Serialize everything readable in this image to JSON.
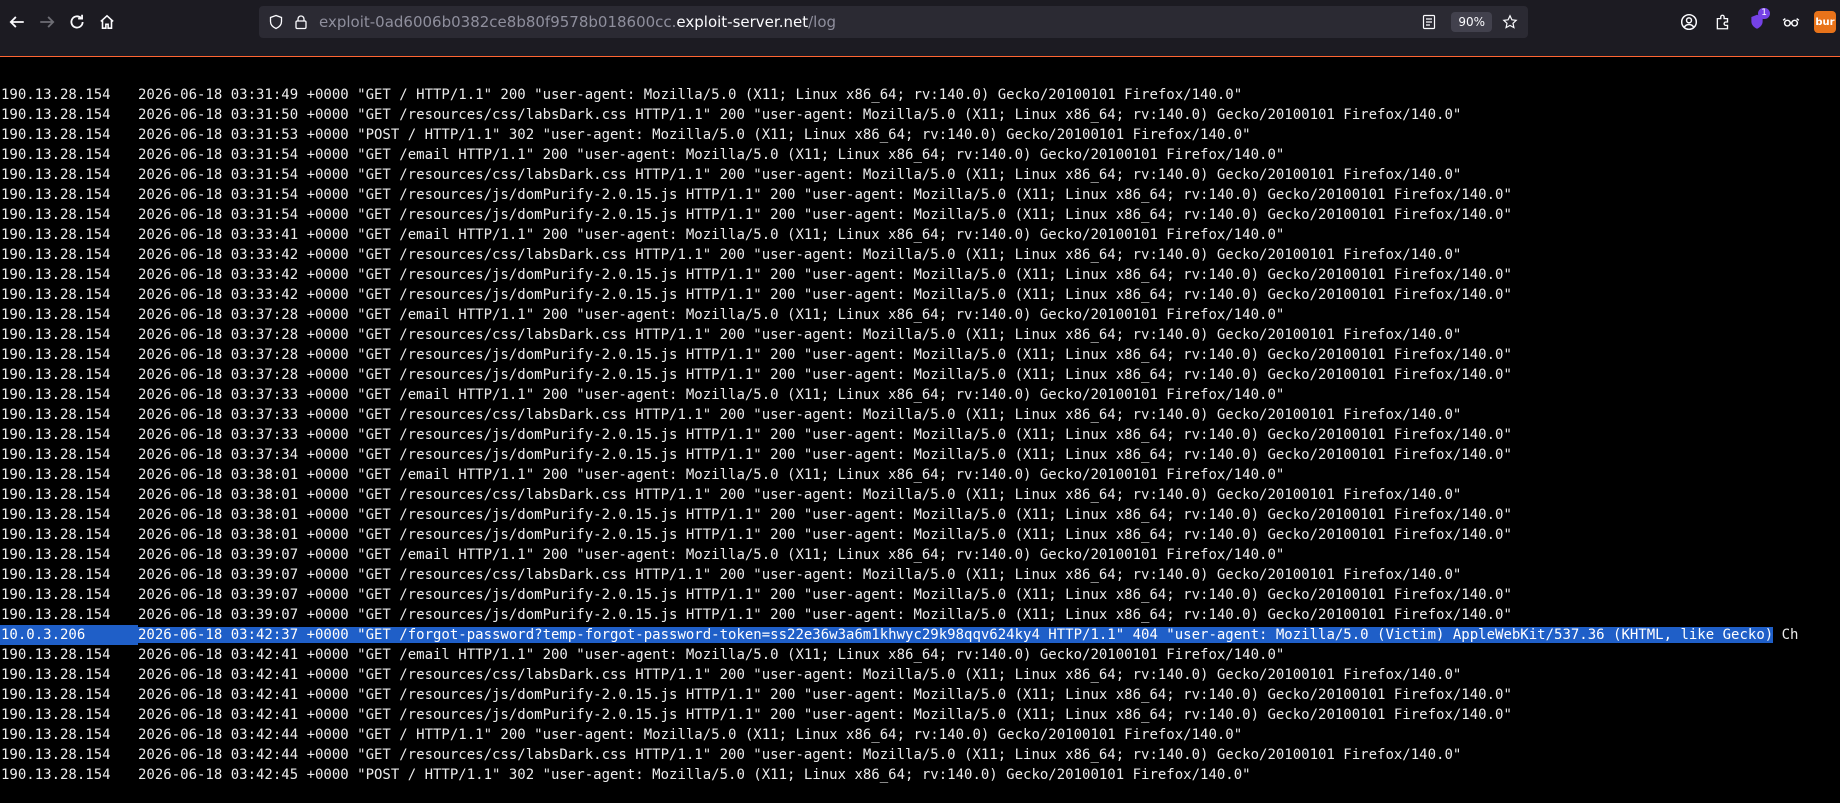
{
  "browser": {
    "url_prefix": "exploit-0ad6006b0382ce8b80f9578b018600cc.",
    "url_host": "exploit-server.net",
    "url_path": "/log",
    "zoom": "90%",
    "extension_badge": "1",
    "burp_label": "bur"
  },
  "log": {
    "selected_row_index": 27,
    "rows": [
      {
        "ip": "190.13.28.154",
        "rest": "2026-06-18 03:31:49 +0000 \"GET / HTTP/1.1\" 200 \"user-agent: Mozilla/5.0 (X11; Linux x86_64; rv:140.0) Gecko/20100101 Firefox/140.0\""
      },
      {
        "ip": "190.13.28.154",
        "rest": "2026-06-18 03:31:50 +0000 \"GET /resources/css/labsDark.css HTTP/1.1\" 200 \"user-agent: Mozilla/5.0 (X11; Linux x86_64; rv:140.0) Gecko/20100101 Firefox/140.0\""
      },
      {
        "ip": "190.13.28.154",
        "rest": "2026-06-18 03:31:53 +0000 \"POST / HTTP/1.1\" 302 \"user-agent: Mozilla/5.0 (X11; Linux x86_64; rv:140.0) Gecko/20100101 Firefox/140.0\""
      },
      {
        "ip": "190.13.28.154",
        "rest": "2026-06-18 03:31:54 +0000 \"GET /email HTTP/1.1\" 200 \"user-agent: Mozilla/5.0 (X11; Linux x86_64; rv:140.0) Gecko/20100101 Firefox/140.0\""
      },
      {
        "ip": "190.13.28.154",
        "rest": "2026-06-18 03:31:54 +0000 \"GET /resources/css/labsDark.css HTTP/1.1\" 200 \"user-agent: Mozilla/5.0 (X11; Linux x86_64; rv:140.0) Gecko/20100101 Firefox/140.0\""
      },
      {
        "ip": "190.13.28.154",
        "rest": "2026-06-18 03:31:54 +0000 \"GET /resources/js/domPurify-2.0.15.js HTTP/1.1\" 200 \"user-agent: Mozilla/5.0 (X11; Linux x86_64; rv:140.0) Gecko/20100101 Firefox/140.0\""
      },
      {
        "ip": "190.13.28.154",
        "rest": "2026-06-18 03:31:54 +0000 \"GET /resources/js/domPurify-2.0.15.js HTTP/1.1\" 200 \"user-agent: Mozilla/5.0 (X11; Linux x86_64; rv:140.0) Gecko/20100101 Firefox/140.0\""
      },
      {
        "ip": "190.13.28.154",
        "rest": "2026-06-18 03:33:41 +0000 \"GET /email HTTP/1.1\" 200 \"user-agent: Mozilla/5.0 (X11; Linux x86_64; rv:140.0) Gecko/20100101 Firefox/140.0\""
      },
      {
        "ip": "190.13.28.154",
        "rest": "2026-06-18 03:33:42 +0000 \"GET /resources/css/labsDark.css HTTP/1.1\" 200 \"user-agent: Mozilla/5.0 (X11; Linux x86_64; rv:140.0) Gecko/20100101 Firefox/140.0\""
      },
      {
        "ip": "190.13.28.154",
        "rest": "2026-06-18 03:33:42 +0000 \"GET /resources/js/domPurify-2.0.15.js HTTP/1.1\" 200 \"user-agent: Mozilla/5.0 (X11; Linux x86_64; rv:140.0) Gecko/20100101 Firefox/140.0\""
      },
      {
        "ip": "190.13.28.154",
        "rest": "2026-06-18 03:33:42 +0000 \"GET /resources/js/domPurify-2.0.15.js HTTP/1.1\" 200 \"user-agent: Mozilla/5.0 (X11; Linux x86_64; rv:140.0) Gecko/20100101 Firefox/140.0\""
      },
      {
        "ip": "190.13.28.154",
        "rest": "2026-06-18 03:37:28 +0000 \"GET /email HTTP/1.1\" 200 \"user-agent: Mozilla/5.0 (X11; Linux x86_64; rv:140.0) Gecko/20100101 Firefox/140.0\""
      },
      {
        "ip": "190.13.28.154",
        "rest": "2026-06-18 03:37:28 +0000 \"GET /resources/css/labsDark.css HTTP/1.1\" 200 \"user-agent: Mozilla/5.0 (X11; Linux x86_64; rv:140.0) Gecko/20100101 Firefox/140.0\""
      },
      {
        "ip": "190.13.28.154",
        "rest": "2026-06-18 03:37:28 +0000 \"GET /resources/js/domPurify-2.0.15.js HTTP/1.1\" 200 \"user-agent: Mozilla/5.0 (X11; Linux x86_64; rv:140.0) Gecko/20100101 Firefox/140.0\""
      },
      {
        "ip": "190.13.28.154",
        "rest": "2026-06-18 03:37:28 +0000 \"GET /resources/js/domPurify-2.0.15.js HTTP/1.1\" 200 \"user-agent: Mozilla/5.0 (X11; Linux x86_64; rv:140.0) Gecko/20100101 Firefox/140.0\""
      },
      {
        "ip": "190.13.28.154",
        "rest": "2026-06-18 03:37:33 +0000 \"GET /email HTTP/1.1\" 200 \"user-agent: Mozilla/5.0 (X11; Linux x86_64; rv:140.0) Gecko/20100101 Firefox/140.0\""
      },
      {
        "ip": "190.13.28.154",
        "rest": "2026-06-18 03:37:33 +0000 \"GET /resources/css/labsDark.css HTTP/1.1\" 200 \"user-agent: Mozilla/5.0 (X11; Linux x86_64; rv:140.0) Gecko/20100101 Firefox/140.0\""
      },
      {
        "ip": "190.13.28.154",
        "rest": "2026-06-18 03:37:33 +0000 \"GET /resources/js/domPurify-2.0.15.js HTTP/1.1\" 200 \"user-agent: Mozilla/5.0 (X11; Linux x86_64; rv:140.0) Gecko/20100101 Firefox/140.0\""
      },
      {
        "ip": "190.13.28.154",
        "rest": "2026-06-18 03:37:34 +0000 \"GET /resources/js/domPurify-2.0.15.js HTTP/1.1\" 200 \"user-agent: Mozilla/5.0 (X11; Linux x86_64; rv:140.0) Gecko/20100101 Firefox/140.0\""
      },
      {
        "ip": "190.13.28.154",
        "rest": "2026-06-18 03:38:01 +0000 \"GET /email HTTP/1.1\" 200 \"user-agent: Mozilla/5.0 (X11; Linux x86_64; rv:140.0) Gecko/20100101 Firefox/140.0\""
      },
      {
        "ip": "190.13.28.154",
        "rest": "2026-06-18 03:38:01 +0000 \"GET /resources/css/labsDark.css HTTP/1.1\" 200 \"user-agent: Mozilla/5.0 (X11; Linux x86_64; rv:140.0) Gecko/20100101 Firefox/140.0\""
      },
      {
        "ip": "190.13.28.154",
        "rest": "2026-06-18 03:38:01 +0000 \"GET /resources/js/domPurify-2.0.15.js HTTP/1.1\" 200 \"user-agent: Mozilla/5.0 (X11; Linux x86_64; rv:140.0) Gecko/20100101 Firefox/140.0\""
      },
      {
        "ip": "190.13.28.154",
        "rest": "2026-06-18 03:38:01 +0000 \"GET /resources/js/domPurify-2.0.15.js HTTP/1.1\" 200 \"user-agent: Mozilla/5.0 (X11; Linux x86_64; rv:140.0) Gecko/20100101 Firefox/140.0\""
      },
      {
        "ip": "190.13.28.154",
        "rest": "2026-06-18 03:39:07 +0000 \"GET /email HTTP/1.1\" 200 \"user-agent: Mozilla/5.0 (X11; Linux x86_64; rv:140.0) Gecko/20100101 Firefox/140.0\""
      },
      {
        "ip": "190.13.28.154",
        "rest": "2026-06-18 03:39:07 +0000 \"GET /resources/css/labsDark.css HTTP/1.1\" 200 \"user-agent: Mozilla/5.0 (X11; Linux x86_64; rv:140.0) Gecko/20100101 Firefox/140.0\""
      },
      {
        "ip": "190.13.28.154",
        "rest": "2026-06-18 03:39:07 +0000 \"GET /resources/js/domPurify-2.0.15.js HTTP/1.1\" 200 \"user-agent: Mozilla/5.0 (X11; Linux x86_64; rv:140.0) Gecko/20100101 Firefox/140.0\""
      },
      {
        "ip": "190.13.28.154",
        "rest": "2026-06-18 03:39:07 +0000 \"GET /resources/js/domPurify-2.0.15.js HTTP/1.1\" 200 \"user-agent: Mozilla/5.0 (X11; Linux x86_64; rv:140.0) Gecko/20100101 Firefox/140.0\""
      },
      {
        "ip": "10.0.3.206",
        "rest": "2026-06-18 03:42:37 +0000 \"GET /forgot-password?temp-forgot-password-token=ss22e36w3a6m1khwyc29k98qqv624ky4 HTTP/1.1\" 404 \"user-agent: Mozilla/5.0 (Victim) AppleWebKit/537.36 (KHTML, like Gecko)",
        "tail": " Ch"
      },
      {
        "ip": "190.13.28.154",
        "rest": "2026-06-18 03:42:41 +0000 \"GET /email HTTP/1.1\" 200 \"user-agent: Mozilla/5.0 (X11; Linux x86_64; rv:140.0) Gecko/20100101 Firefox/140.0\""
      },
      {
        "ip": "190.13.28.154",
        "rest": "2026-06-18 03:42:41 +0000 \"GET /resources/css/labsDark.css HTTP/1.1\" 200 \"user-agent: Mozilla/5.0 (X11; Linux x86_64; rv:140.0) Gecko/20100101 Firefox/140.0\""
      },
      {
        "ip": "190.13.28.154",
        "rest": "2026-06-18 03:42:41 +0000 \"GET /resources/js/domPurify-2.0.15.js HTTP/1.1\" 200 \"user-agent: Mozilla/5.0 (X11; Linux x86_64; rv:140.0) Gecko/20100101 Firefox/140.0\""
      },
      {
        "ip": "190.13.28.154",
        "rest": "2026-06-18 03:42:41 +0000 \"GET /resources/js/domPurify-2.0.15.js HTTP/1.1\" 200 \"user-agent: Mozilla/5.0 (X11; Linux x86_64; rv:140.0) Gecko/20100101 Firefox/140.0\""
      },
      {
        "ip": "190.13.28.154",
        "rest": "2026-06-18 03:42:44 +0000 \"GET / HTTP/1.1\" 200 \"user-agent: Mozilla/5.0 (X11; Linux x86_64; rv:140.0) Gecko/20100101 Firefox/140.0\""
      },
      {
        "ip": "190.13.28.154",
        "rest": "2026-06-18 03:42:44 +0000 \"GET /resources/css/labsDark.css HTTP/1.1\" 200 \"user-agent: Mozilla/5.0 (X11; Linux x86_64; rv:140.0) Gecko/20100101 Firefox/140.0\""
      },
      {
        "ip": "190.13.28.154",
        "rest": "2026-06-18 03:42:45 +0000 \"POST / HTTP/1.1\" 302 \"user-agent: Mozilla/5.0 (X11; Linux x86_64; rv:140.0) Gecko/20100101 Firefox/140.0\""
      }
    ]
  }
}
